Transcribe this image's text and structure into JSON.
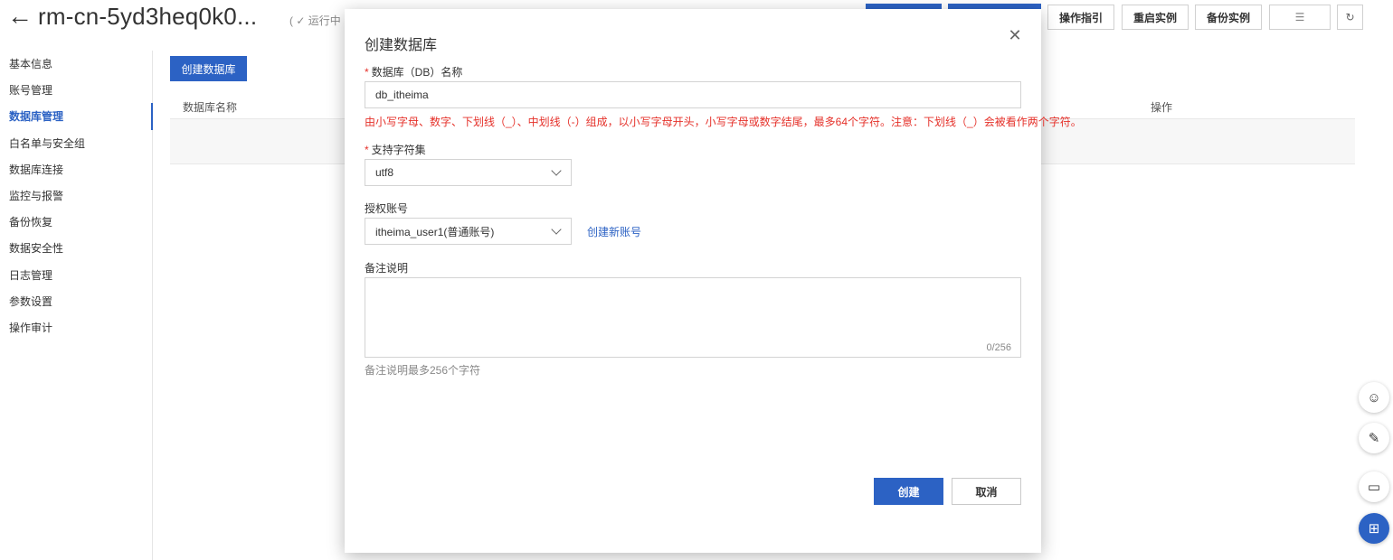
{
  "header": {
    "back_icon": "back-arrow-icon",
    "instance_title": "rm-cn-5yd3heq0k0...",
    "status": "( ✓ 运行中",
    "buttons": [
      "操作指引",
      "重启实例",
      "备份实例"
    ]
  },
  "sidebar": {
    "items": [
      {
        "label": "基本信息"
      },
      {
        "label": "账号管理"
      },
      {
        "label": "数据库管理",
        "active": true
      },
      {
        "label": "白名单与安全组"
      },
      {
        "label": "数据库连接"
      },
      {
        "label": "监控与报警"
      },
      {
        "label": "备份恢复"
      },
      {
        "label": "数据安全性"
      },
      {
        "label": "日志管理"
      },
      {
        "label": "参数设置"
      },
      {
        "label": "操作审计"
      }
    ]
  },
  "main": {
    "create_button": "创建数据库",
    "columns": [
      "数据库名称",
      "操作"
    ]
  },
  "modal": {
    "title": "创建数据库",
    "db_name": {
      "required_mark": "*",
      "label": "数据库（DB）名称",
      "value": "db_itheima",
      "error": "由小写字母、数字、下划线（_）、中划线（-）组成，以小写字母开头，小写字母或数字结尾，最多64个字符。注意：下划线（_）会被看作两个字符。"
    },
    "charset": {
      "required_mark": "*",
      "label": "支持字符集",
      "value": "utf8"
    },
    "account": {
      "label": "授权账号",
      "value": "itheima_user1(普通账号)",
      "create_link": "创建新账号"
    },
    "remark": {
      "label": "备注说明",
      "counter": "0/256",
      "hint": "备注说明最多256个字符"
    },
    "confirm_label": "创建",
    "cancel_label": "取消"
  },
  "colors": {
    "primary": "#2c62c4",
    "error": "#e5312a"
  }
}
